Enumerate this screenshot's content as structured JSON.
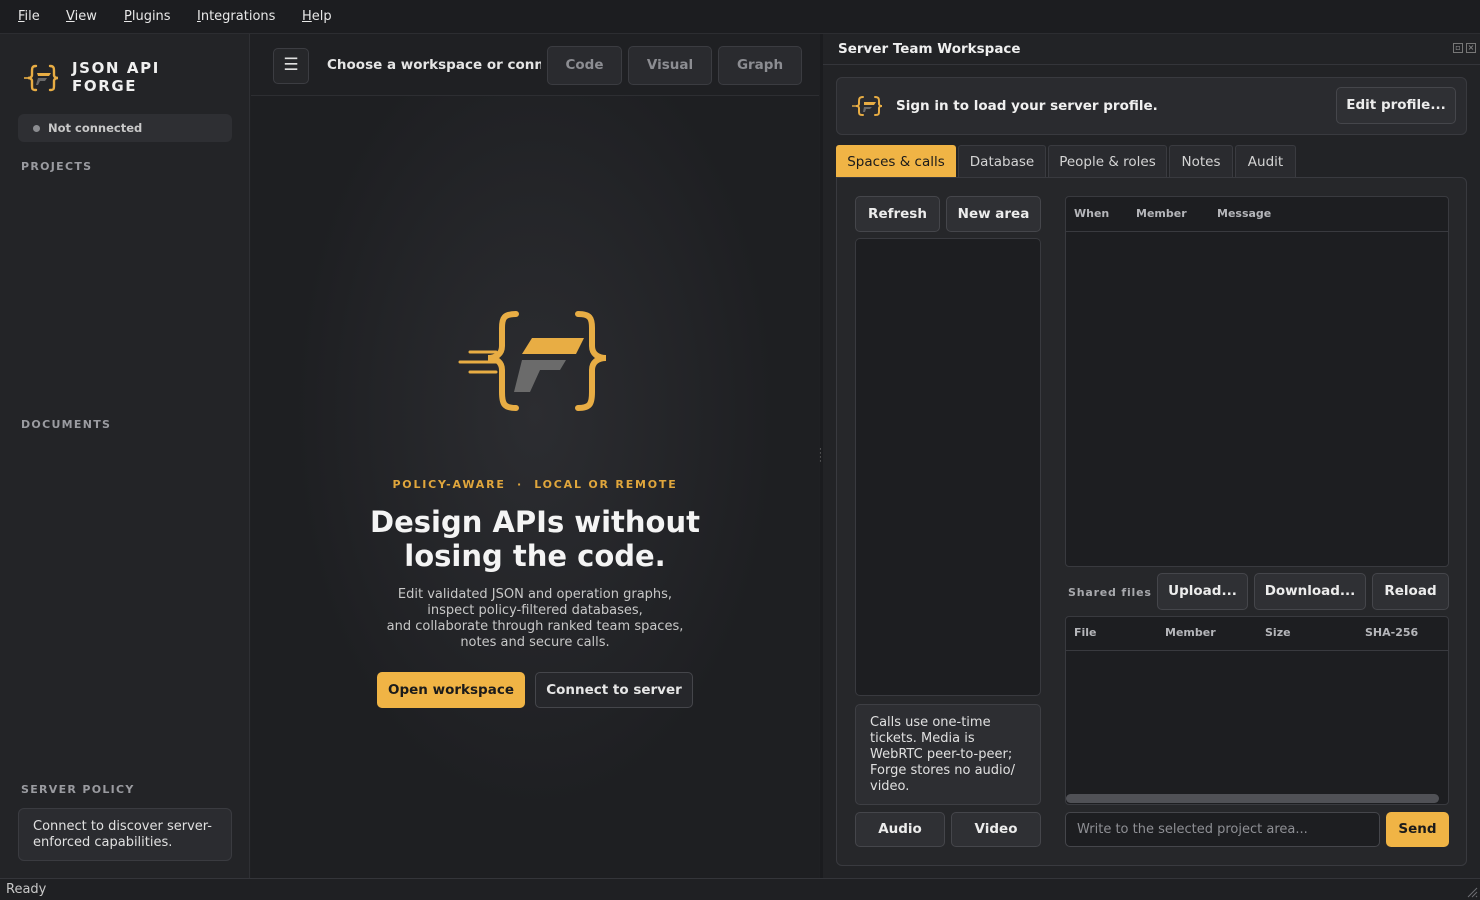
{
  "menu": {
    "items": [
      {
        "mnemonic": "F",
        "rest": "ile"
      },
      {
        "mnemonic": "V",
        "rest": "iew"
      },
      {
        "mnemonic": "P",
        "rest": "lugins"
      },
      {
        "mnemonic": "I",
        "rest": "ntegrations"
      },
      {
        "mnemonic": "H",
        "rest": "elp"
      }
    ]
  },
  "sidebar": {
    "brand_line1": "JSON API",
    "brand_line2": "FORGE",
    "connection_status": "Not connected",
    "projects_label": "PROJECTS",
    "documents_label": "DOCUMENTS",
    "server_policy_label": "SERVER POLICY",
    "server_policy_text": "Connect to discover server-enforced capabilities."
  },
  "toolbar": {
    "menu_icon": "☰",
    "workspace_prompt": "Choose a workspace or connect",
    "view_buttons": [
      "Code",
      "Visual",
      "Graph"
    ]
  },
  "hero": {
    "tagline": "POLICY-AWARE  ·  LOCAL OR REMOTE",
    "title_line1": "Design APIs without",
    "title_line2": "losing the code.",
    "desc_line1": "Edit validated JSON and operation graphs,",
    "desc_line2": "inspect policy-filtered databases,",
    "desc_line3": "and collaborate through ranked team spaces,",
    "desc_line4": "notes and secure calls.",
    "open_workspace": "Open workspace",
    "connect_server": "Connect to server"
  },
  "dock": {
    "title": "Server Team Workspace",
    "profile_prompt": "Sign in to load your server profile.",
    "edit_profile": "Edit profile...",
    "tabs": [
      "Spaces & calls",
      "Database",
      "People & roles",
      "Notes",
      "Audit"
    ],
    "active_tab": "Spaces & calls",
    "refresh": "Refresh",
    "new_area": "New area",
    "call_note": "Calls use one-time tickets. Media is WebRTC peer-to-peer; Forge stores no audio/ video.",
    "audio": "Audio",
    "video": "Video",
    "messages_columns": [
      "When",
      "Member",
      "Message"
    ],
    "shared_files_label": "Shared files",
    "upload": "Upload...",
    "download": "Download...",
    "reload": "Reload",
    "files_columns": [
      "File",
      "Member",
      "Size",
      "SHA-256"
    ],
    "message_placeholder": "Write to the selected project area...",
    "send": "Send"
  },
  "status": {
    "text": "Ready"
  },
  "colors": {
    "accent": "#f0b445",
    "background": "#1f2023"
  },
  "icons": {
    "brand": "forge-logo-icon",
    "menu": "hamburger-icon",
    "resize": "resize-grip-icon"
  }
}
